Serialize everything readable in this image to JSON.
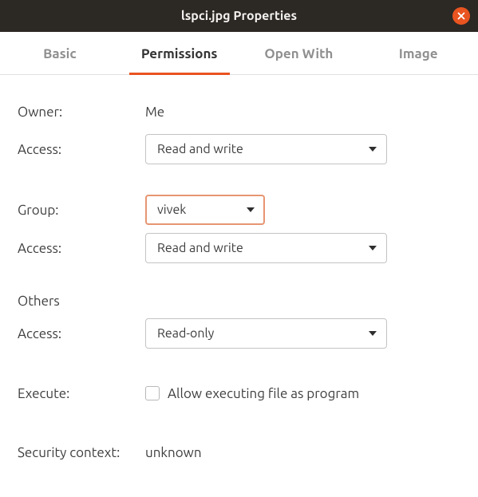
{
  "window": {
    "title": "lspci.jpg Properties"
  },
  "tabs": {
    "basic": "Basic",
    "permissions": "Permissions",
    "open_with": "Open With",
    "image": "Image"
  },
  "permissions": {
    "owner_label": "Owner:",
    "owner_value": "Me",
    "owner_access_label": "Access:",
    "owner_access_value": "Read and write",
    "group_label": "Group:",
    "group_value": "vivek",
    "group_access_label": "Access:",
    "group_access_value": "Read and write",
    "others_header": "Others",
    "others_access_label": "Access:",
    "others_access_value": "Read-only",
    "execute_label": "Execute:",
    "execute_checkbox_label": "Allow executing file as program",
    "execute_checked": false,
    "security_context_label": "Security context:",
    "security_context_value": "unknown"
  },
  "colors": {
    "accent": "#e95420",
    "titlebar_bg": "#2c2824"
  }
}
